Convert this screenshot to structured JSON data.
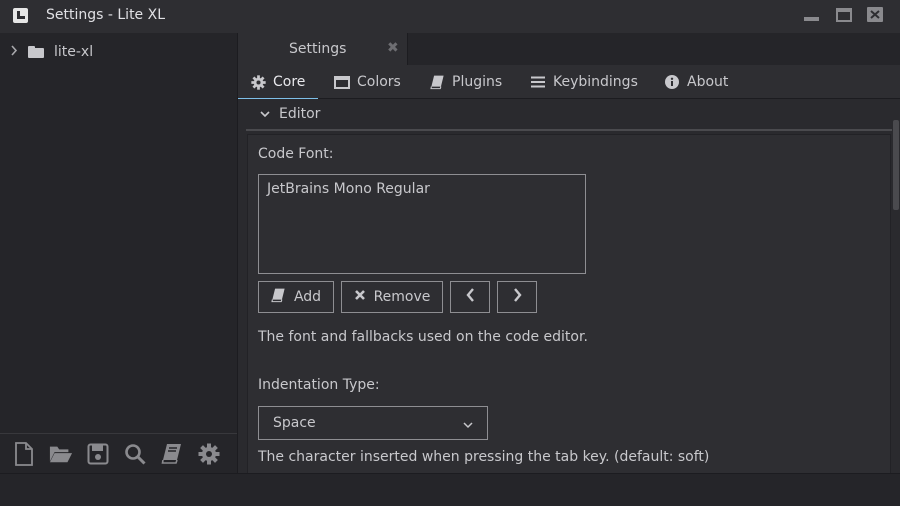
{
  "window": {
    "title": "Settings - Lite XL",
    "controls": {
      "minimize": "minimize-icon",
      "maximize": "maximize-icon",
      "close": "close-icon"
    }
  },
  "sidebar": {
    "tree": [
      {
        "label": "lite-xl",
        "icon": "folder-icon",
        "expanded": false
      }
    ],
    "toolbar": [
      "new-file-icon",
      "open-folder-icon",
      "save-icon",
      "search-icon",
      "book-icon",
      "gear-icon"
    ]
  },
  "tabs": [
    {
      "label": "Settings",
      "close": "✖",
      "active": true
    }
  ],
  "settings_tabs": [
    {
      "label": "Core",
      "icon": "gear-icon",
      "active": true
    },
    {
      "label": "Colors",
      "icon": "window-icon",
      "active": false
    },
    {
      "label": "Plugins",
      "icon": "book-icon",
      "active": false
    },
    {
      "label": "Keybindings",
      "icon": "list-icon",
      "active": false
    },
    {
      "label": "About",
      "icon": "info-icon",
      "active": false
    }
  ],
  "editor_section": {
    "title": "Editor",
    "code_font": {
      "label": "Code Font:",
      "fonts": [
        "JetBrains Mono Regular"
      ],
      "buttons": {
        "add": "Add",
        "remove": "Remove"
      },
      "description": "The font and fallbacks used on the code editor."
    },
    "indentation": {
      "label": "Indentation Type:",
      "selected": "Space",
      "description": "The character inserted when pressing the tab key. (default: soft)"
    }
  },
  "colors": {
    "accent": "#7ebfe8",
    "background": "#2e2e32",
    "sidebar": "#252529",
    "text": "#c8c8cc"
  }
}
